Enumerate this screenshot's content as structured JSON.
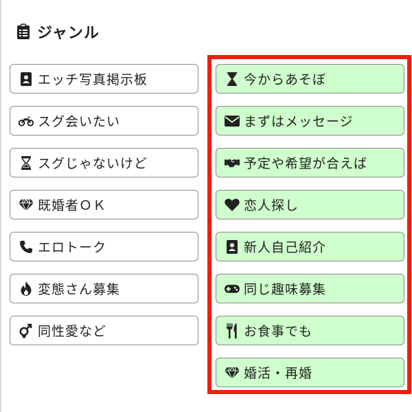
{
  "header": {
    "title": "ジャンル",
    "icon": "clipboard-icon"
  },
  "left_genres": [
    {
      "label": "エッチ写真掲示板",
      "icon": "contact-card-icon"
    },
    {
      "label": "スグ会いたい",
      "icon": "motorcycle-icon"
    },
    {
      "label": "スグじゃないけど",
      "icon": "hourglass-icon"
    },
    {
      "label": "既婚者ＯＫ",
      "icon": "diamond-icon"
    },
    {
      "label": "エロトーク",
      "icon": "phone-icon"
    },
    {
      "label": "変態さん募集",
      "icon": "fire-icon"
    },
    {
      "label": "同性愛など",
      "icon": "gender-icon"
    }
  ],
  "right_genres": [
    {
      "label": "今からあそぼ",
      "icon": "hourglass-icon"
    },
    {
      "label": "まずはメッセージ",
      "icon": "envelope-icon"
    },
    {
      "label": "予定や希望が合えば",
      "icon": "handshake-icon"
    },
    {
      "label": "恋人探し",
      "icon": "heart-icon"
    },
    {
      "label": "新人自己紹介",
      "icon": "contact-card-icon"
    },
    {
      "label": "同じ趣味募集",
      "icon": "gamepad-icon"
    },
    {
      "label": "お食事でも",
      "icon": "utensils-icon"
    },
    {
      "label": "婚活・再婚",
      "icon": "diamond-icon"
    }
  ],
  "colors": {
    "right_button_bg": "#cfffcc",
    "highlight_border": "#f41c0d",
    "border": "#8a8a8a"
  }
}
